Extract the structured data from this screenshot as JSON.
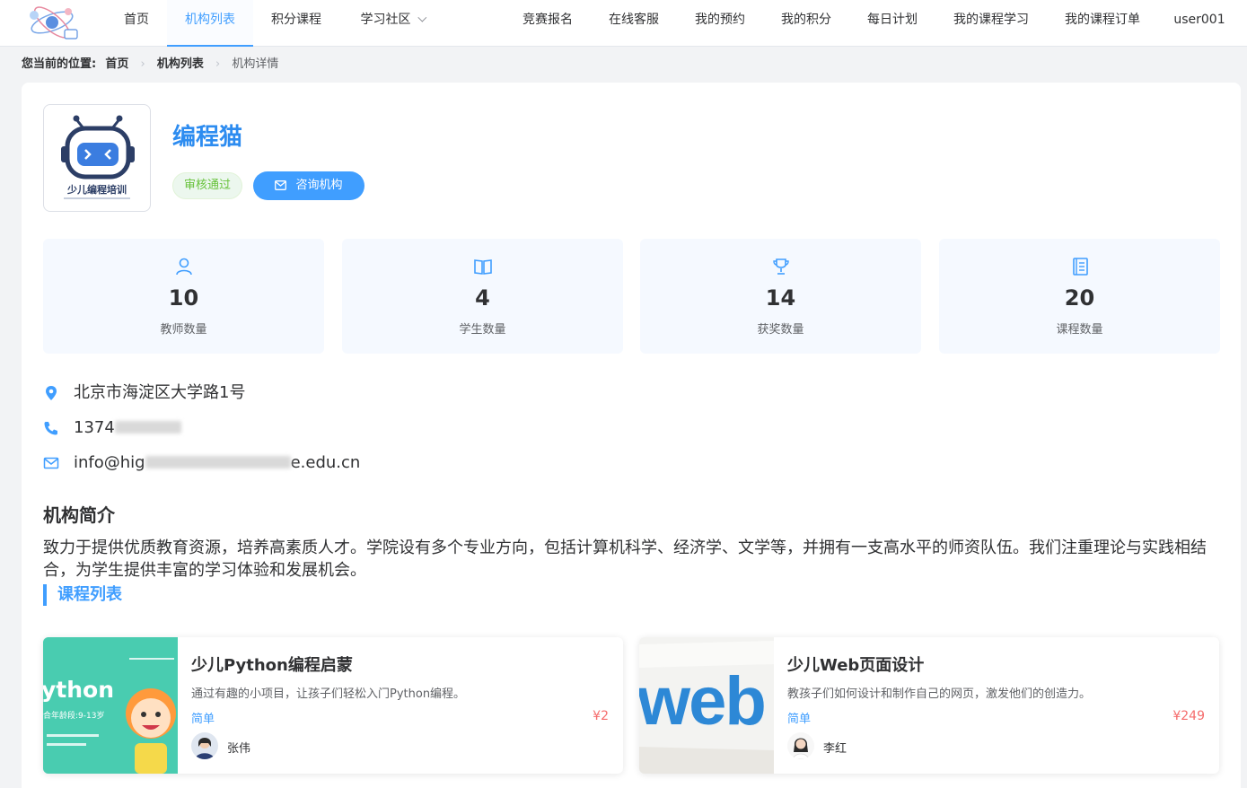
{
  "nav": {
    "items": [
      {
        "label": "首页"
      },
      {
        "label": "机构列表",
        "active": true
      },
      {
        "label": "积分课程"
      },
      {
        "label": "学习社区"
      },
      {
        "label": "竞赛报名"
      },
      {
        "label": "在线客服"
      },
      {
        "label": "我的预约"
      },
      {
        "label": "我的积分"
      },
      {
        "label": "每日计划"
      },
      {
        "label": "我的课程学习"
      },
      {
        "label": "我的课程订单"
      }
    ],
    "user": "user001"
  },
  "breadcrumb": {
    "lead": "您当前的位置:",
    "items": [
      "首页",
      "机构列表",
      "机构详情"
    ]
  },
  "org": {
    "name": "编程猫",
    "logo_text": "少儿编程培训",
    "status": "审核通过",
    "consult_label": "咨询机构",
    "stats": [
      {
        "value": "10",
        "label": "教师数量",
        "icon": "user-icon"
      },
      {
        "value": "4",
        "label": "学生数量",
        "icon": "book-icon"
      },
      {
        "value": "14",
        "label": "获奖数量",
        "icon": "trophy-icon"
      },
      {
        "value": "20",
        "label": "课程数量",
        "icon": "notebook-icon"
      }
    ],
    "address": "北京市海淀区大学路1号",
    "phone_visible": "1374",
    "email_prefix": "info@hig",
    "email_suffix": "e.edu.cn",
    "intro_title": "机构简介",
    "intro": "致力于提供优质教育资源，培养高素质人才。学院设有多个专业方向，包括计算机科学、经济学、文学等，并拥有一支高水平的师资队伍。我们注重理论与实践相结合，为学生提供丰富的学习体验和发展机会。",
    "courses_title": "课程列表"
  },
  "courses": [
    {
      "title": "少儿Python编程启蒙",
      "desc": "通过有趣的小项目，让孩子们轻松入门Python编程。",
      "level": "简单",
      "price": "¥2",
      "teacher": "张伟",
      "thumb_text": "ython",
      "thumb_sub": "合年龄段:9-13岁"
    },
    {
      "title": "少儿Web页面设计",
      "desc": "教孩子们如何设计和制作自己的网页，激发他们的创造力。",
      "level": "简单",
      "price": "¥249",
      "teacher": "李红",
      "thumb_text": "web"
    }
  ],
  "colors": {
    "accent": "#409eff",
    "price": "#f56c6c",
    "success": "#67c23a",
    "title": "#2d8cf0"
  }
}
